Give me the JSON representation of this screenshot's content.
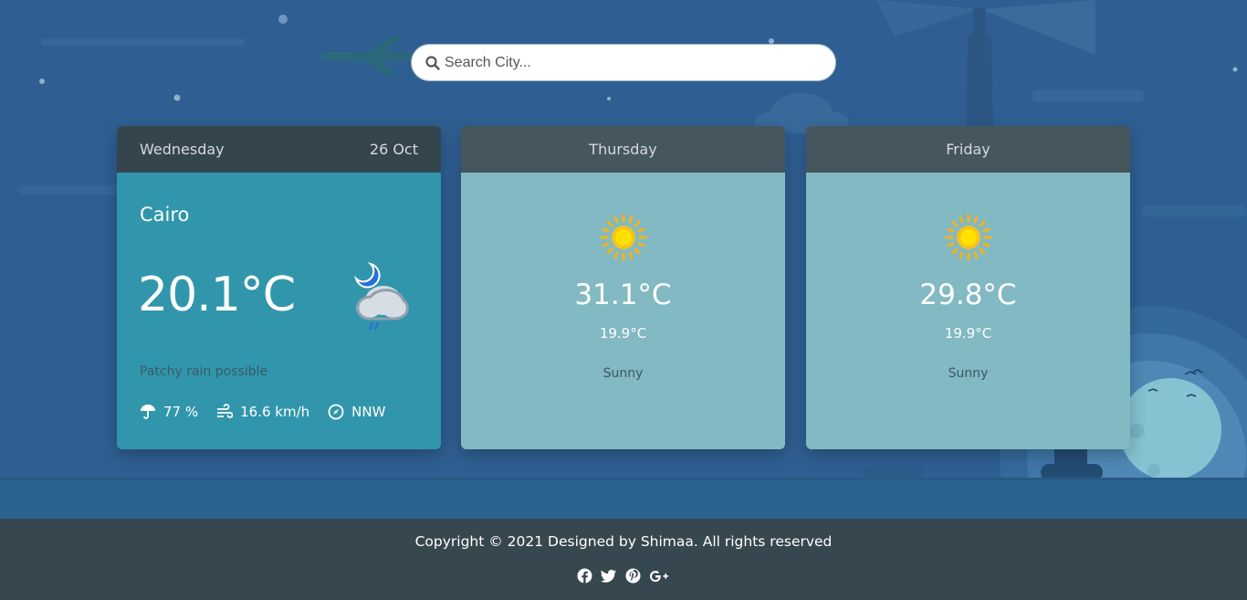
{
  "search": {
    "placeholder": "Search City..."
  },
  "today": {
    "day": "Wednesday",
    "date": "26 Oct",
    "city": "Cairo",
    "temperature": "20.1°C",
    "condition": "Patchy rain possible",
    "condition_icon": "night-cloud-rain-icon",
    "humidity": "77 %",
    "wind_speed": "16.6 km/h",
    "wind_direction": "NNW"
  },
  "forecast": [
    {
      "day": "Thursday",
      "max": "31.1°C",
      "min": "19.9°C",
      "condition": "Sunny",
      "icon": "sun-icon"
    },
    {
      "day": "Friday",
      "max": "29.8°C",
      "min": "19.9°C",
      "condition": "Sunny",
      "icon": "sun-icon"
    }
  ],
  "footer": {
    "copyright": "Copyright © 2021 Designed by Shimaa. All rights reserved",
    "social": [
      "facebook-icon",
      "twitter-icon",
      "pinterest-icon",
      "google-plus-icon"
    ]
  },
  "colors": {
    "background": "#2f5f92",
    "today_card": "#3196ab",
    "forecast_card": "#82b9c3",
    "card_header": "#45565f",
    "footer": "#37474f"
  }
}
